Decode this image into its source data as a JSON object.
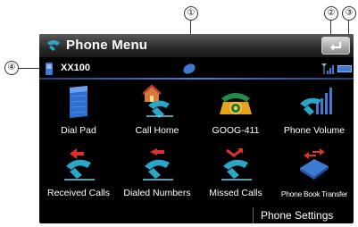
{
  "callouts": [
    "①",
    "②",
    "③",
    "④"
  ],
  "header": {
    "title": "Phone Menu",
    "back_icon": "back-arrow-icon"
  },
  "status": {
    "device_name": "XX100",
    "icons": [
      "phone-device-icon",
      "bluetooth-icon",
      "signal-strength-icon",
      "battery-icon"
    ]
  },
  "menu": {
    "items": [
      {
        "label": "Dial Pad",
        "icon": "dial-pad-icon"
      },
      {
        "label": "Call Home",
        "icon": "call-home-icon"
      },
      {
        "label": "GOOG-411",
        "icon": "telephone-icon"
      },
      {
        "label": "Phone Volume",
        "icon": "volume-icon"
      },
      {
        "label": "Received Calls",
        "icon": "received-calls-icon"
      },
      {
        "label": "Dialed Numbers",
        "icon": "dialed-numbers-icon"
      },
      {
        "label": "Missed Calls",
        "icon": "missed-calls-icon"
      },
      {
        "label": "Phone Book Transfer",
        "icon": "phone-book-transfer-icon"
      }
    ]
  },
  "footer": {
    "settings_label": "Phone Settings"
  },
  "colors": {
    "accent": "#3d7bd3",
    "background": "#000000",
    "handset": "#2aa6c9",
    "arrow": "#e0302a"
  }
}
